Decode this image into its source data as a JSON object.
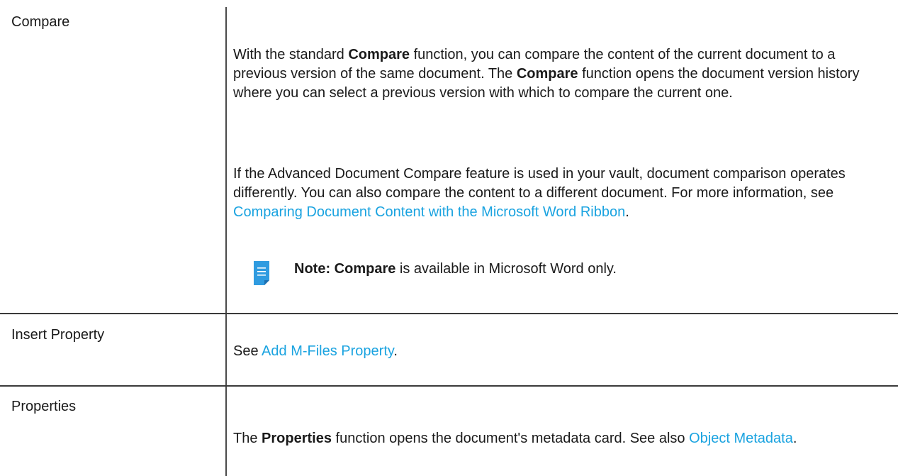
{
  "rows": [
    {
      "label": "Compare",
      "p1": {
        "t1": "With the standard ",
        "b1": "Compare",
        "t2": " function, you can compare the content of the current document to a previous version of the same document. The ",
        "b2": "Compare",
        "t3": " function opens the document version history where you can select a previous version with which to compare the current one."
      },
      "p2": {
        "t1": "If the Advanced Document Compare feature is used in your vault, document comparison operates differently. You can also compare the content to a different document. For more information, see ",
        "link": "Comparing Document Content with the Microsoft Word Ribbon",
        "t2": "."
      },
      "note": {
        "prefix": "Note:",
        "bold": "Compare",
        "text": " is available in Microsoft Word only.",
        "icon": "note-icon"
      }
    },
    {
      "label": "Insert Property",
      "p1": {
        "t1": "See ",
        "link": "Add M-Files Property",
        "t2": "."
      }
    },
    {
      "label": "Properties",
      "p1": {
        "t1": "The ",
        "b1": "Properties",
        "t2": " function opens the document's metadata card. See also ",
        "link": "Object Metadata",
        "t3": "."
      }
    }
  ],
  "colors": {
    "link": "#1aa3e0",
    "note_icon": "#2f9be0",
    "rule": "#3a3a3a"
  }
}
